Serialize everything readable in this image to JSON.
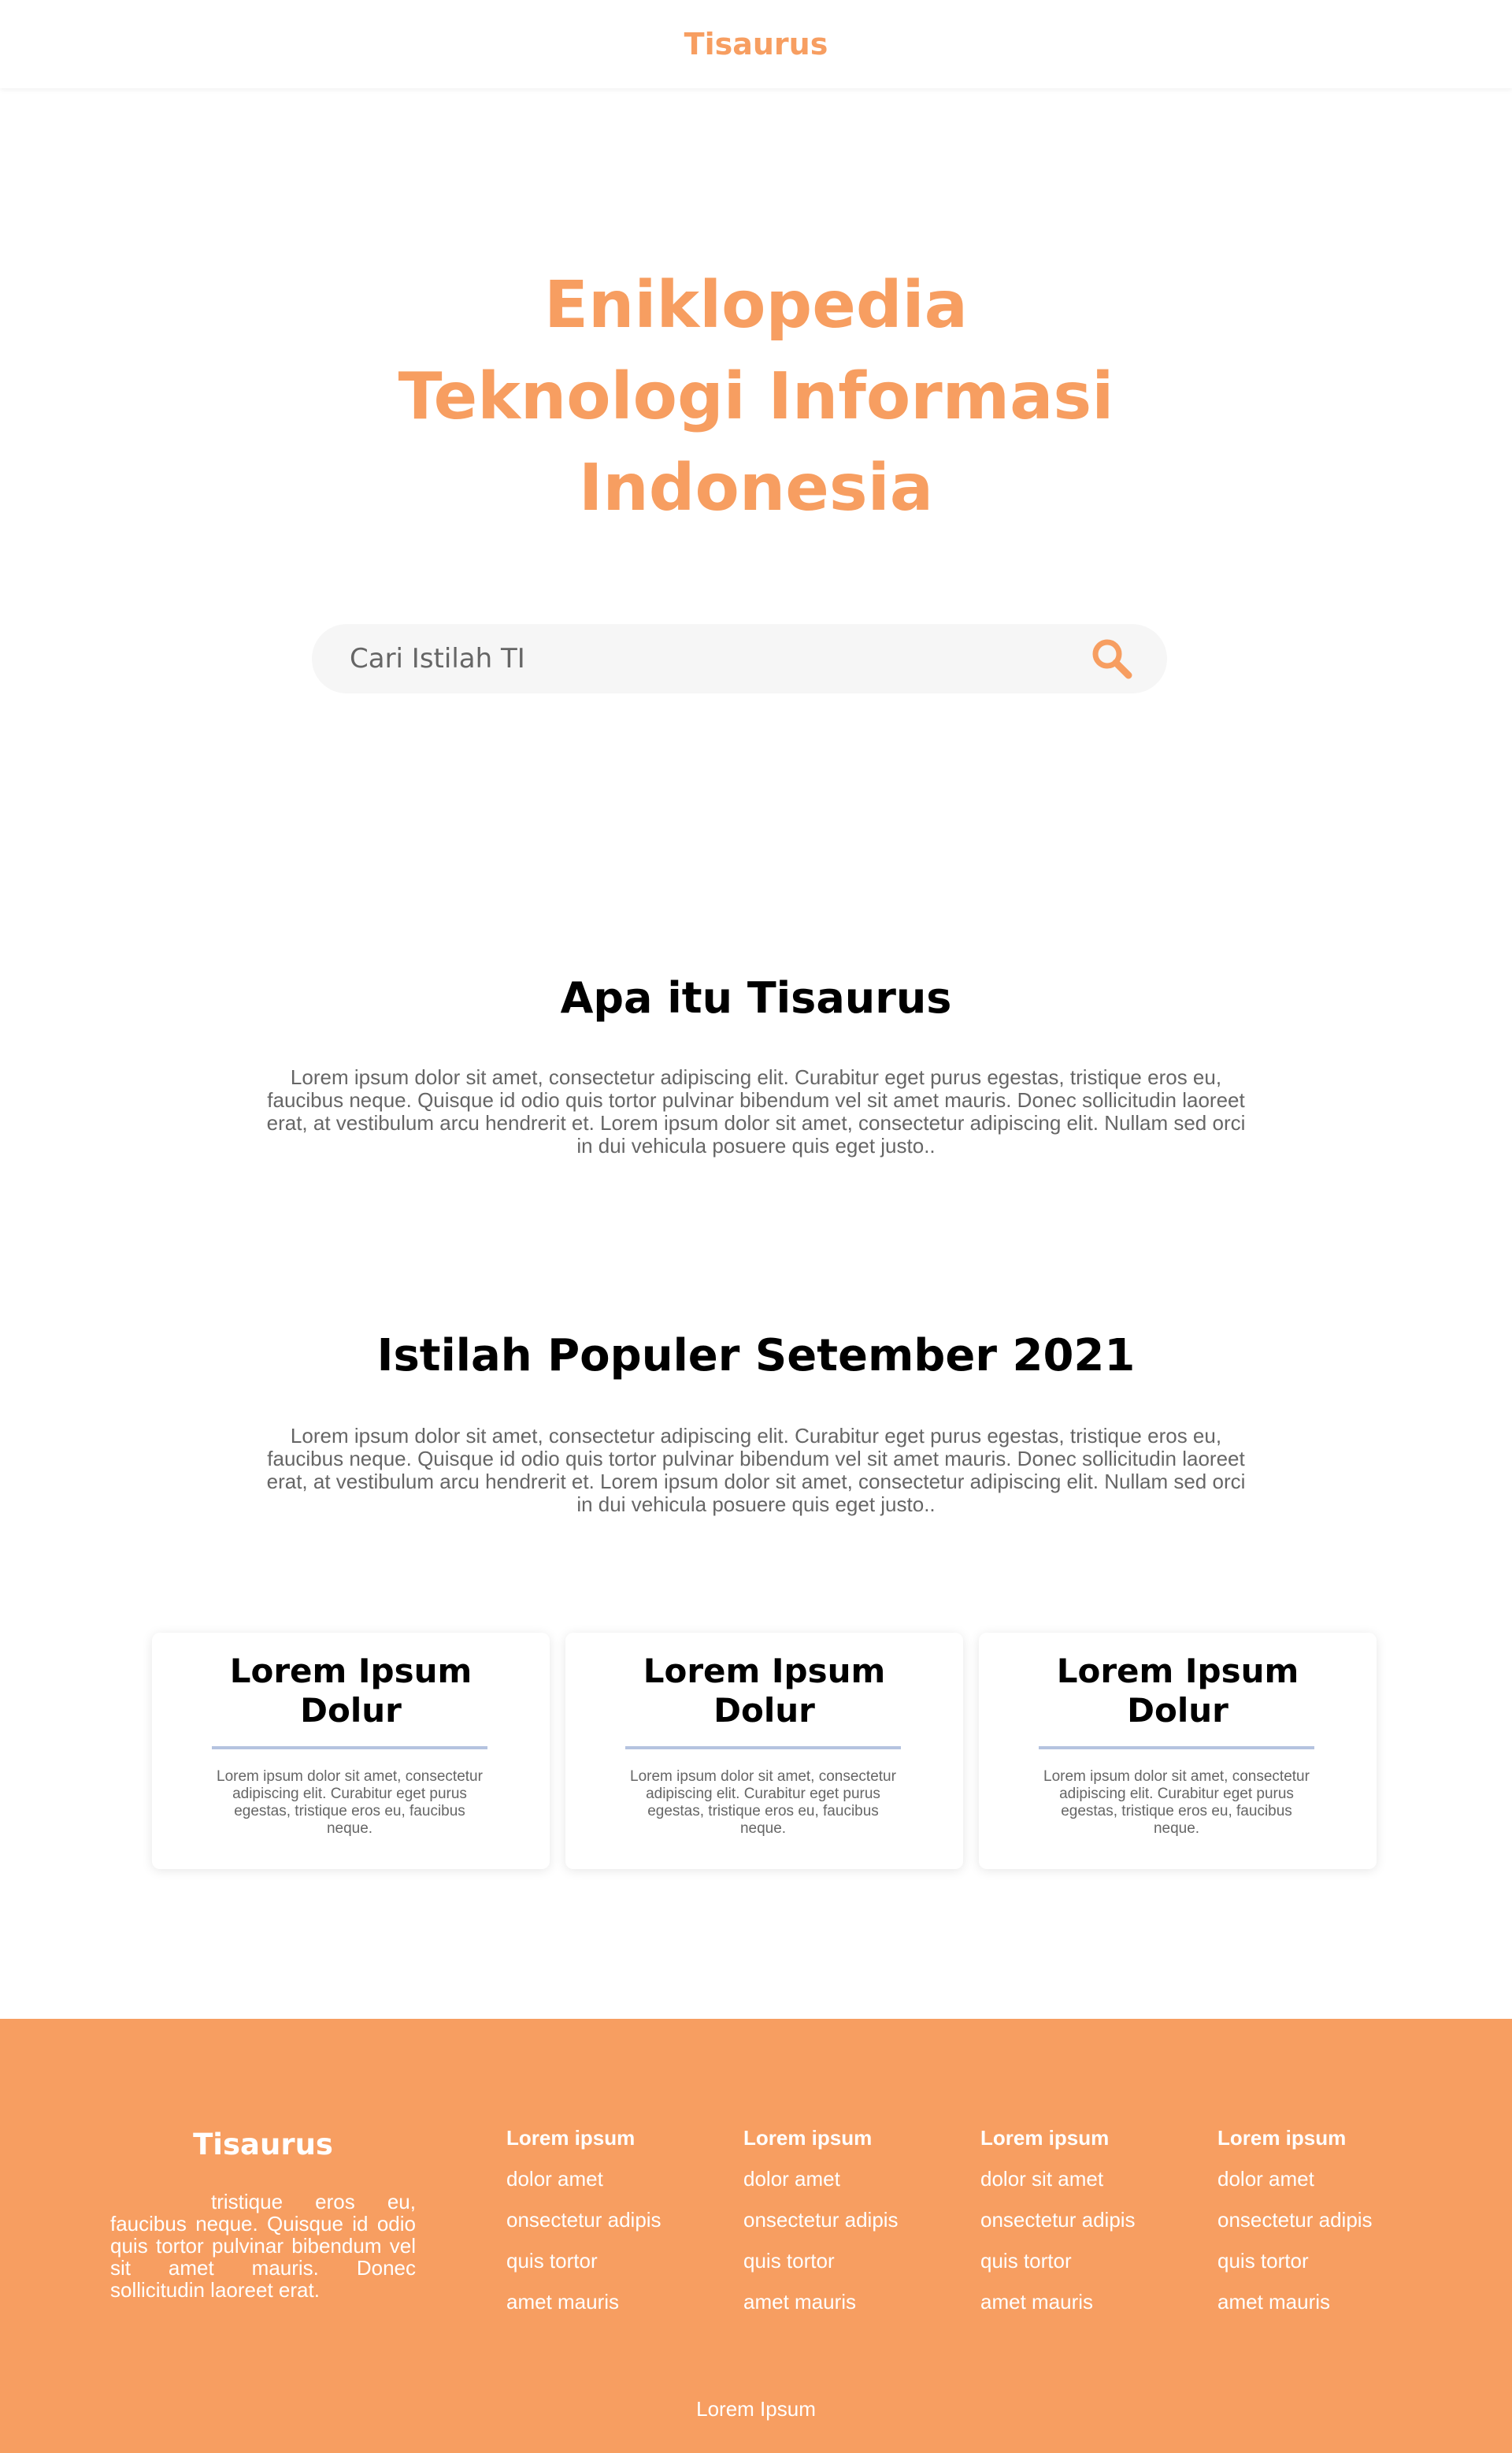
{
  "header": {
    "brand": "Tisaurus"
  },
  "hero": {
    "title_line1": "Eniklopedia",
    "title_line2": "Teknologi Informasi",
    "title_line3": "Indonesia",
    "search_placeholder": "Cari Istilah TI",
    "search_icon": "search-icon"
  },
  "about": {
    "title": "Apa itu Tisaurus",
    "text": "Lorem ipsum dolor sit amet, consectetur adipiscing elit. Curabitur eget purus egestas, tristique eros eu, faucibus neque. Quisque id odio quis tortor pulvinar bibendum vel sit amet mauris. Donec sollicitudin laoreet erat, at vestibulum arcu hendrerit et. Lorem ipsum dolor sit amet, consectetur adipiscing elit. Nullam sed orci in dui vehicula posuere quis eget justo.."
  },
  "popular": {
    "title": "Istilah Populer Setember 2021",
    "text": "Lorem ipsum dolor sit amet, consectetur adipiscing elit. Curabitur eget purus egestas, tristique eros eu, faucibus neque. Quisque id odio quis tortor pulvinar bibendum vel sit amet mauris. Donec sollicitudin laoreet erat, at vestibulum arcu hendrerit et. Lorem ipsum dolor sit amet, consectetur adipiscing elit. Nullam sed orci in dui vehicula posuere quis eget justo..",
    "cards": [
      {
        "title_line1": "Lorem Ipsum",
        "title_line2": "Dolur",
        "text": "Lorem ipsum dolor sit amet, consectetur adipiscing elit. Curabitur eget purus egestas, tristique eros eu, faucibus neque."
      },
      {
        "title_line1": "Lorem Ipsum",
        "title_line2": "Dolur",
        "text": "Lorem ipsum dolor sit amet, consectetur adipiscing elit. Curabitur eget purus egestas, tristique eros eu, faucibus neque."
      },
      {
        "title_line1": "Lorem Ipsum",
        "title_line2": "Dolur",
        "text": "Lorem ipsum dolor sit amet, consectetur adipiscing elit. Curabitur eget purus egestas, tristique eros eu, faucibus neque."
      }
    ]
  },
  "footer": {
    "brand": "Tisaurus",
    "description": "tristique eros eu, faucibus neque. Quisque id odio quis tortor pulvinar bibendum vel sit amet mauris. Donec sollicitudin laoreet erat.",
    "columns": [
      {
        "title": "Lorem ipsum",
        "items": [
          "dolor  amet",
          "onsectetur adipis",
          "quis tortor",
          "amet mauris"
        ]
      },
      {
        "title": "Lorem ipsum",
        "items": [
          "dolor amet",
          "onsectetur adipis",
          "quis tortor",
          "amet mauris"
        ]
      },
      {
        "title": "Lorem ipsum",
        "items": [
          "dolor sit amet",
          "onsectetur adipis",
          "quis tortor",
          "amet mauris"
        ]
      },
      {
        "title": "Lorem ipsum",
        "items": [
          "dolor amet",
          "onsectetur adipis",
          "quis tortor",
          "amet mauris"
        ]
      }
    ],
    "copyright": "Lorem Ipsum"
  },
  "colors": {
    "accent": "#F79E61",
    "search_bg": "#f6f6f6",
    "card_rule": "#b5c3e0"
  }
}
